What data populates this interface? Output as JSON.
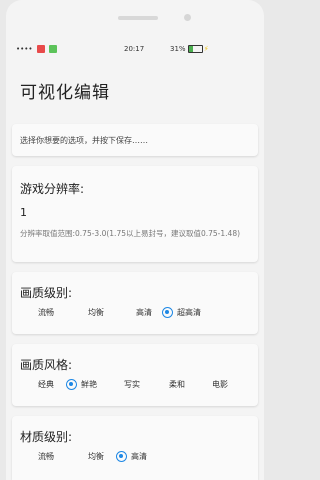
{
  "status_bar": {
    "time": "20:17",
    "battery": "31%",
    "left_text": "••••"
  },
  "page": {
    "title": "可视化编辑"
  },
  "hint": {
    "text": "选择你想要的选项，并按下保存……"
  },
  "resolution": {
    "label": "游戏分辨率:",
    "value": "1",
    "description": "分辨率取值范围:0.75-3.0(1.75以上易封号，建议取值0.75-1.48)"
  },
  "quality": {
    "label": "画质级别:",
    "options": [
      "流畅",
      "均衡",
      "高清",
      "超高清"
    ],
    "selected": "超高清"
  },
  "style": {
    "label": "画质风格:",
    "options": [
      "经典",
      "鲜艳",
      "写实",
      "柔和",
      "电影"
    ],
    "selected": "鲜艳"
  },
  "material": {
    "label": "材质级别:",
    "options": [
      "流畅",
      "均衡",
      "高清"
    ],
    "selected": "高清"
  },
  "colors": {
    "accent": "#1e88e5",
    "background": "#f4f4f4"
  }
}
